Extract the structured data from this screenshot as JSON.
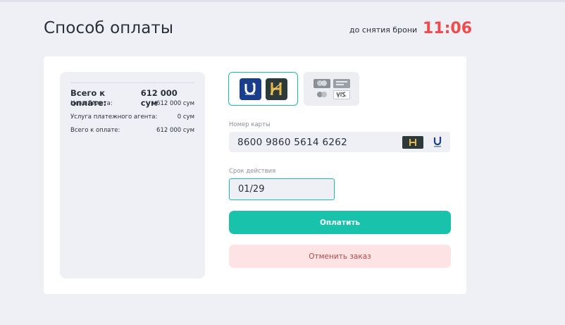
{
  "header": {
    "title": "Способ оплаты",
    "timer_label": "до снятия брони",
    "timer_value": "11:06"
  },
  "summary": {
    "total_label": "Всего к оплате:",
    "total_value": "612 000 сум",
    "rows": [
      {
        "label": "Цена билета:",
        "value": "612 000 сум"
      },
      {
        "label": "Услуга платежного агента:",
        "value": "0 сум"
      },
      {
        "label": "Всего к оплате:",
        "value": "612 000 сум"
      }
    ]
  },
  "payment_methods": {
    "local": {
      "icons": [
        "uzcard-logo-icon",
        "humo-logo-icon"
      ],
      "selected": true
    },
    "international": {
      "icons": [
        "mastercard-logo-icon",
        "maestro-logo-icon",
        "visa-logo-icon",
        "card-network-logo-icon"
      ],
      "selected": false
    }
  },
  "form": {
    "card_label": "Номер карты",
    "card_number": "8600 9860 5614 6262",
    "expiry_label": "Срок действия",
    "expiry_value": "01/29"
  },
  "actions": {
    "pay_label": "Оплатить",
    "cancel_label": "Отменить заказ"
  },
  "colors": {
    "accent": "#19c2aa",
    "timer": "#ef4b4b",
    "cancel_bg": "#fde3e3",
    "cancel_text": "#b54848",
    "page_bg": "#eef0f5"
  }
}
